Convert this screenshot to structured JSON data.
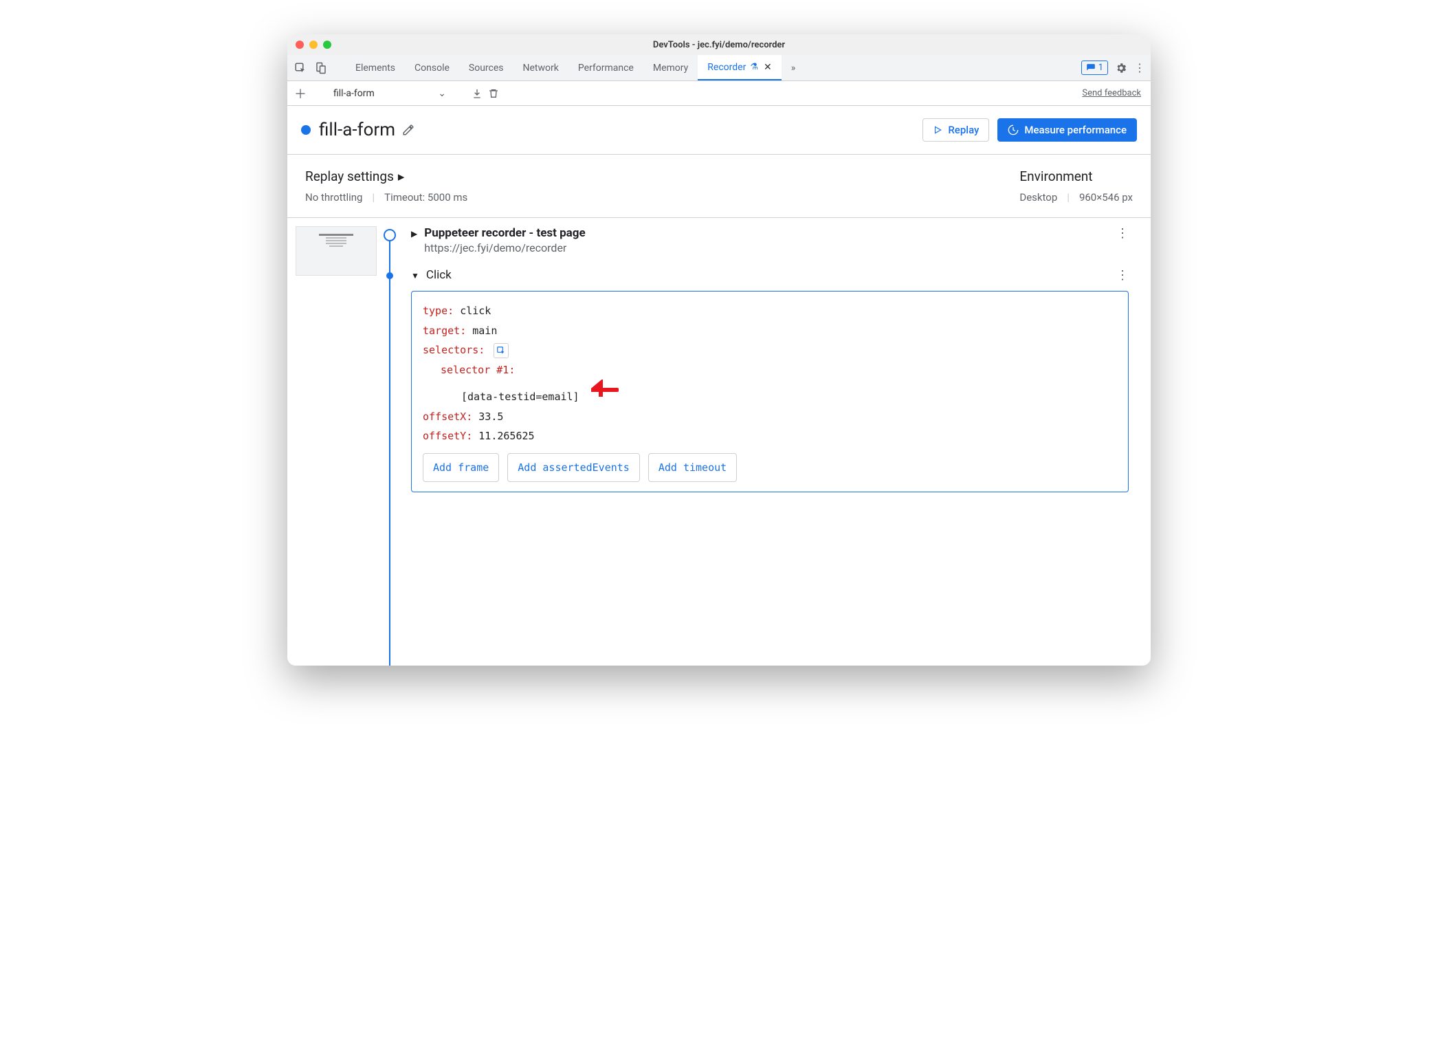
{
  "window": {
    "title": "DevTools - jec.fyi/demo/recorder"
  },
  "tabs": {
    "items": [
      "Elements",
      "Console",
      "Sources",
      "Network",
      "Performance",
      "Memory",
      "Recorder"
    ],
    "active": "Recorder",
    "issues_count": "1"
  },
  "toolbar": {
    "recording_name": "fill-a-form",
    "feedback": "Send feedback"
  },
  "header": {
    "recording_name": "fill-a-form",
    "replay_label": "Replay",
    "measure_label": "Measure performance"
  },
  "settings": {
    "replay_heading": "Replay settings",
    "throttle": "No throttling",
    "timeout": "Timeout: 5000 ms",
    "env_heading": "Environment",
    "device": "Desktop",
    "viewport": "960×546 px"
  },
  "steps": [
    {
      "title": "Puppeteer recorder - test page",
      "url": "https://jec.fyi/demo/recorder"
    },
    {
      "title": "Click",
      "props": {
        "type_label": "type",
        "type_value": "click",
        "target_label": "target",
        "target_value": "main",
        "selectors_label": "selectors",
        "selector1_label": "selector #1",
        "selector1_value": "[data-testid=email]",
        "offsetX_label": "offsetX",
        "offsetX_value": "33.5",
        "offsetY_label": "offsetY",
        "offsetY_value": "11.265625"
      },
      "add_buttons": [
        "Add frame",
        "Add assertedEvents",
        "Add timeout"
      ]
    }
  ]
}
